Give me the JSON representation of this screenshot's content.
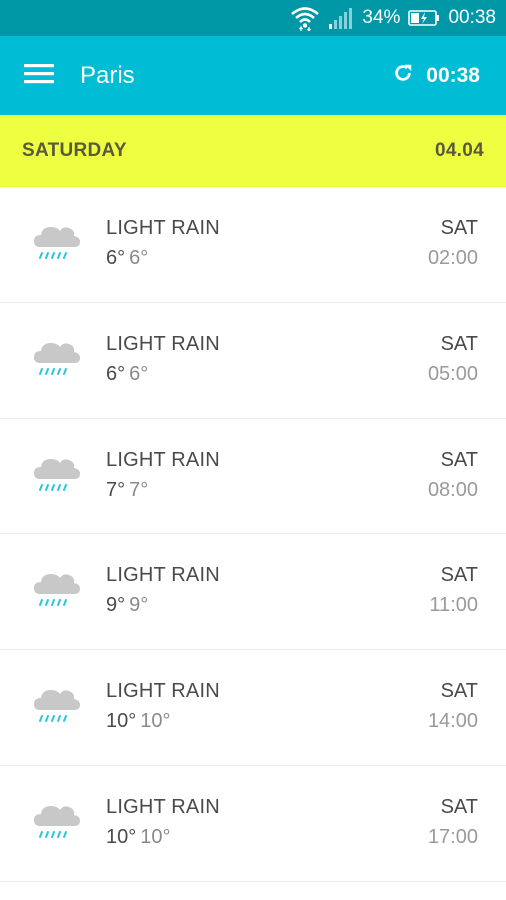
{
  "status_bar": {
    "battery": "34%",
    "time": "00:38"
  },
  "app_bar": {
    "title": "Paris",
    "refresh_time": "00:38",
    "menu_icon": "hamburger-menu-icon",
    "refresh_icon": "refresh-icon"
  },
  "day_header": {
    "day": "SATURDAY",
    "date": "04.04"
  },
  "forecast": [
    {
      "condition": "LIGHT RAIN",
      "temp_max": "6°",
      "temp_min": "6°",
      "day": "SAT",
      "time": "02:00",
      "icon": "light-rain-icon"
    },
    {
      "condition": "LIGHT RAIN",
      "temp_max": "6°",
      "temp_min": "6°",
      "day": "SAT",
      "time": "05:00",
      "icon": "light-rain-icon"
    },
    {
      "condition": "LIGHT RAIN",
      "temp_max": "7°",
      "temp_min": "7°",
      "day": "SAT",
      "time": "08:00",
      "icon": "light-rain-icon"
    },
    {
      "condition": "LIGHT RAIN",
      "temp_max": "9°",
      "temp_min": "9°",
      "day": "SAT",
      "time": "11:00",
      "icon": "light-rain-icon"
    },
    {
      "condition": "LIGHT RAIN",
      "temp_max": "10°",
      "temp_min": "10°",
      "day": "SAT",
      "time": "14:00",
      "icon": "light-rain-icon"
    },
    {
      "condition": "LIGHT RAIN",
      "temp_max": "10°",
      "temp_min": "10°",
      "day": "SAT",
      "time": "17:00",
      "icon": "light-rain-icon"
    }
  ],
  "colors": {
    "status_bar": "#0097a7",
    "app_bar": "#00bcd4",
    "day_header": "#eeff41",
    "rain_drops": "#26c6da",
    "cloud": "#c8c8c8"
  }
}
